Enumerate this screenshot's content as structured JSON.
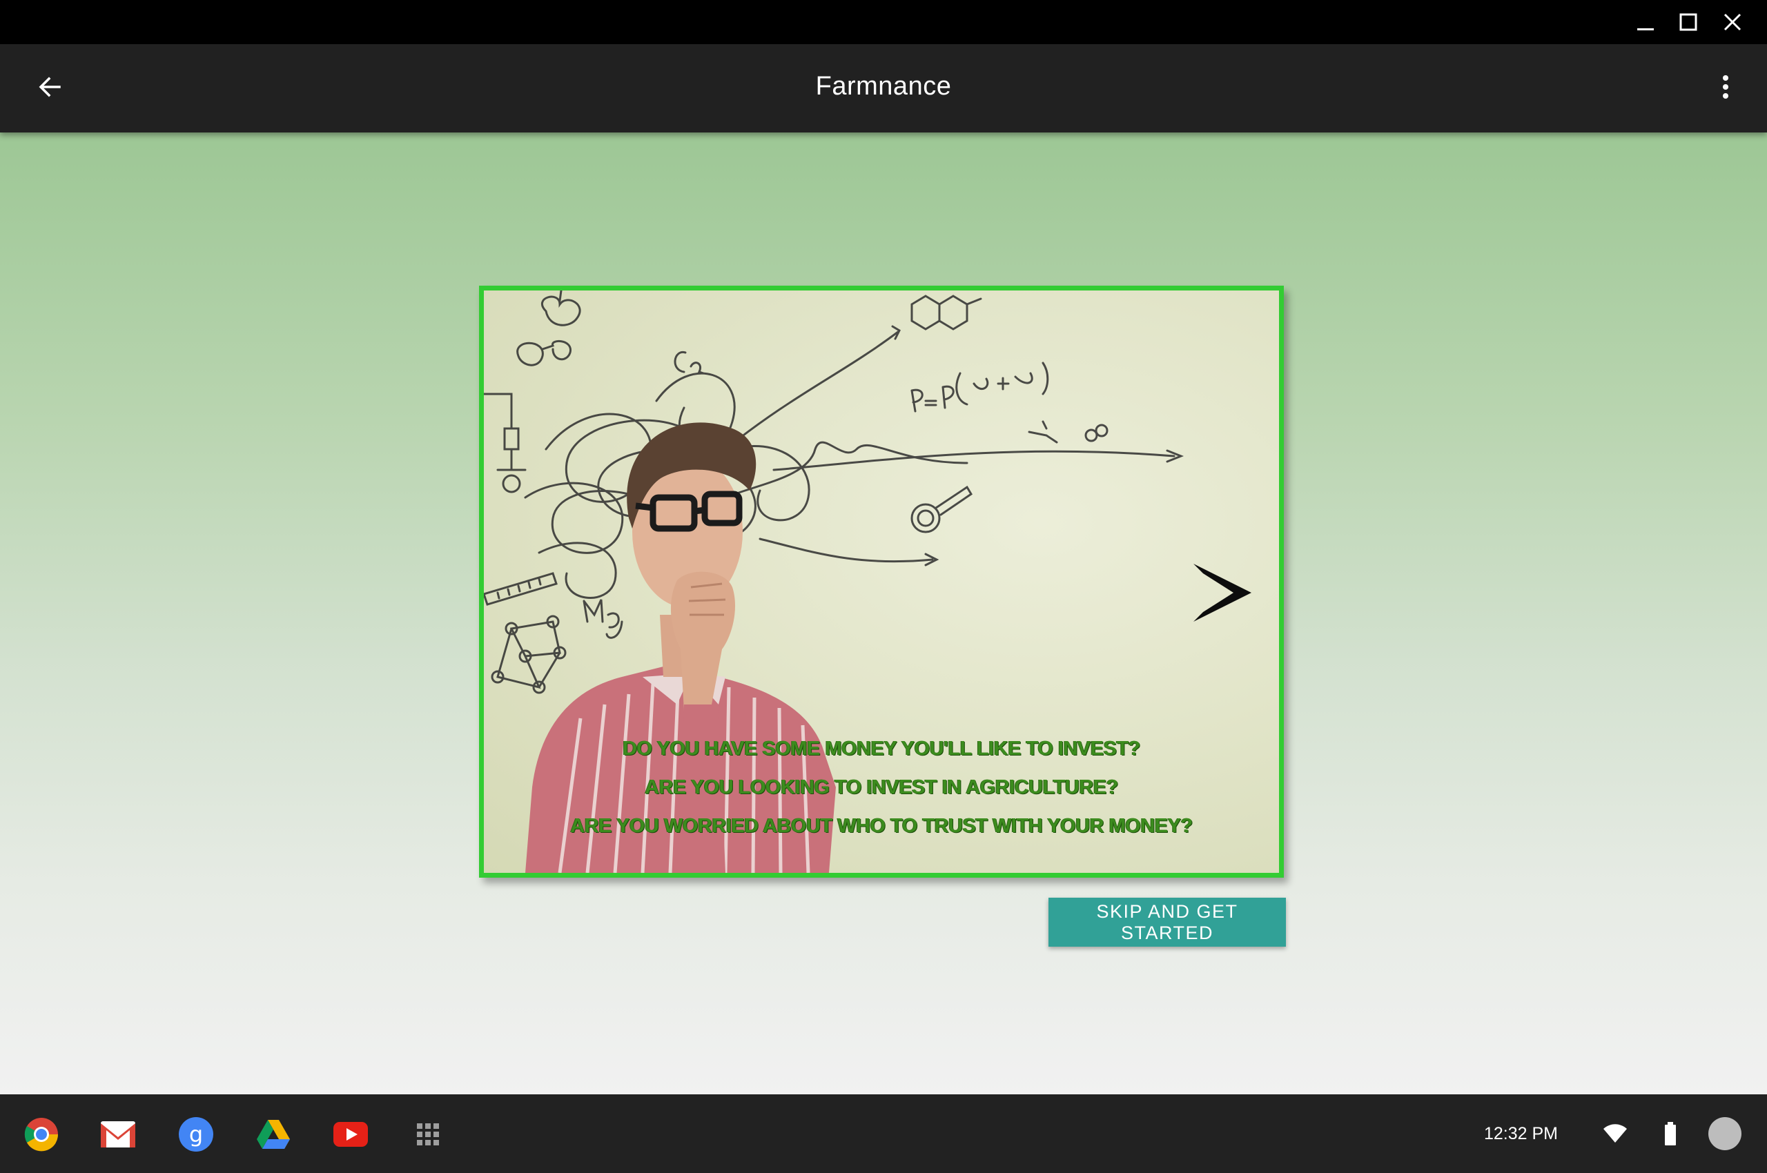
{
  "window": {
    "controls": [
      "minimize-icon",
      "maximize-icon",
      "close-icon"
    ]
  },
  "app_bar": {
    "title": "Farmnance",
    "back_icon": "arrow-left-icon",
    "menu_icon": "more-vert-icon"
  },
  "onboarding": {
    "slide_lines": [
      "DO YOU HAVE SOME MONEY YOU'LL LIKE TO INVEST?",
      "ARE YOU LOOKING TO INVEST IN AGRICULTURE?",
      "ARE YOU WORRIED ABOUT WHO TO TRUST WITH YOUR MONEY?"
    ],
    "next_icon": "chevron-right-icon",
    "skip_label": "SKIP AND GET STARTED"
  },
  "shelf": {
    "apps": [
      "chrome-icon",
      "gmail-icon",
      "google-search-icon",
      "drive-icon",
      "youtube-icon",
      "app-launcher-icon"
    ],
    "clock": "12:32 PM",
    "tray": [
      "wifi-icon",
      "battery-icon",
      "avatar"
    ]
  },
  "colors": {
    "app_bar": "#212121",
    "frame_border": "#33cc33",
    "skip_button": "#31a197",
    "slide_text": "#3c8c1e"
  }
}
